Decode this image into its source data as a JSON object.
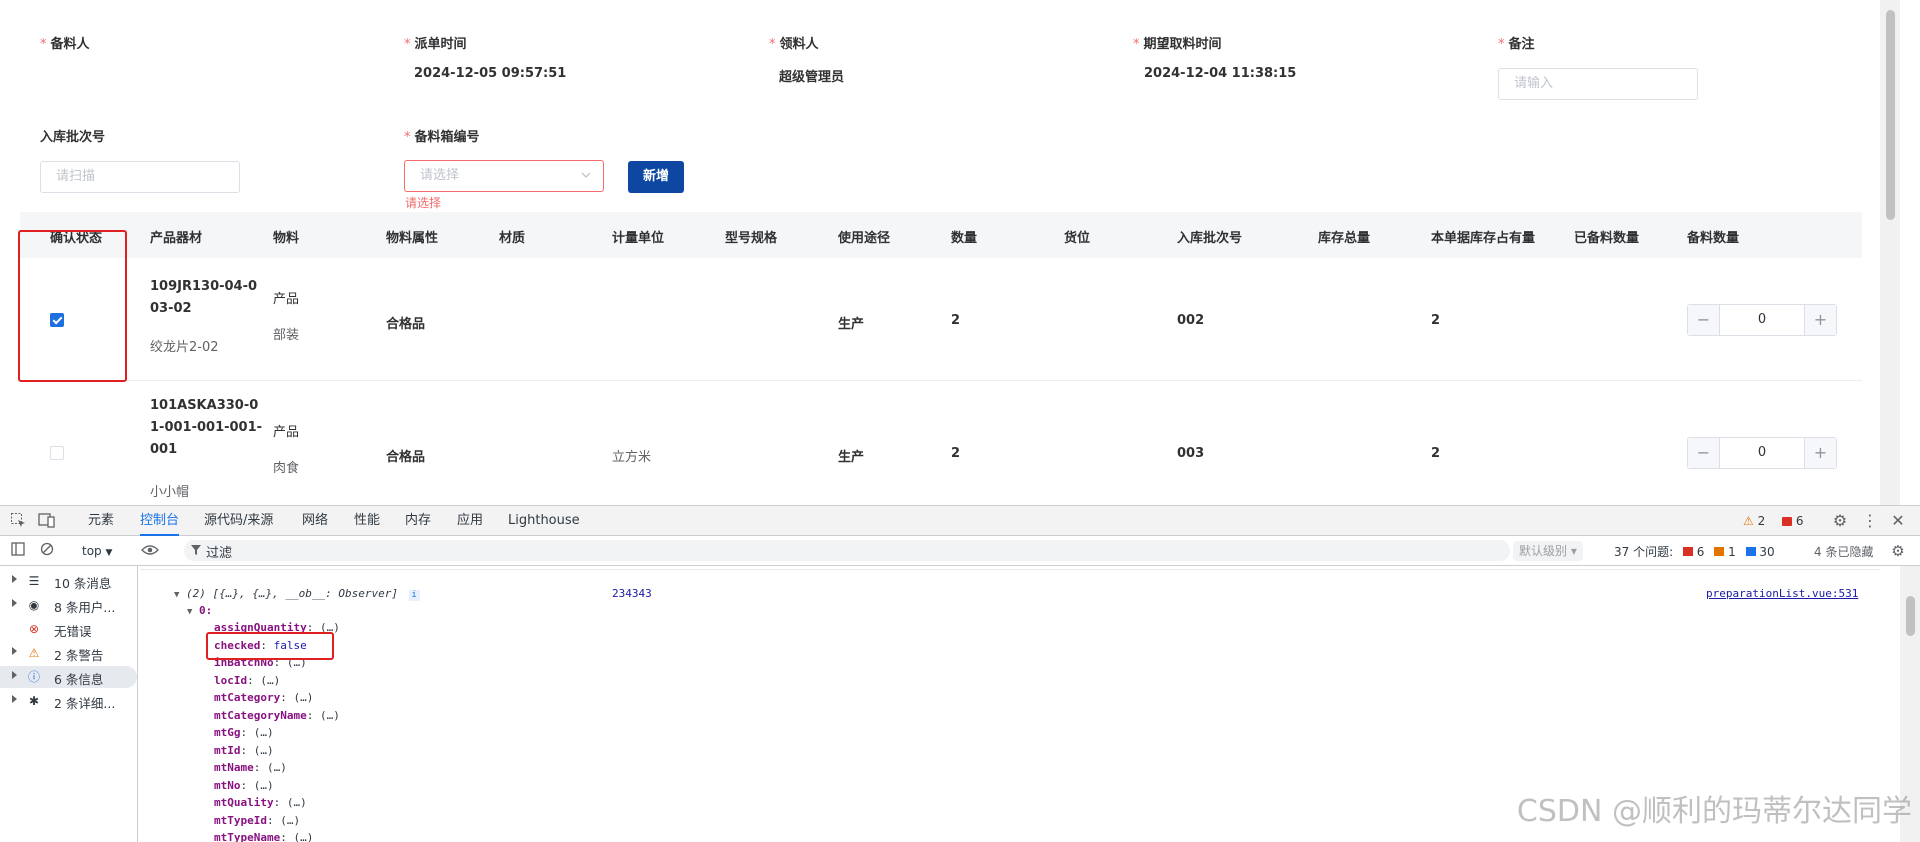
{
  "form": {
    "row1": [
      {
        "label": "备料人",
        "required": true,
        "value": ""
      },
      {
        "label": "派单时间",
        "required": true,
        "value": "2024-12-05 09:57:51"
      },
      {
        "label": "领料人",
        "required": true,
        "value": "超级管理员"
      },
      {
        "label": "期望取料时间",
        "required": true,
        "value": "2024-12-04 11:38:15"
      },
      {
        "label": "备注",
        "required": true,
        "placeholder": "请输入"
      }
    ],
    "batch_label": "入库批次号",
    "batch_placeholder": "请扫描",
    "box_label": "备料箱编号",
    "box_placeholder": "请选择",
    "box_error": "请选择",
    "add_button": "新增"
  },
  "table": {
    "headers": [
      "确认状态",
      "产品器材",
      "物料",
      "物料属性",
      "材质",
      "计量单位",
      "型号规格",
      "使用途径",
      "数量",
      "货位",
      "入库批次号",
      "库存总量",
      "本单据库存占有量",
      "已备料数量",
      "备料数量"
    ],
    "rows": [
      {
        "checked": true,
        "product_code": [
          "109JR130-04-0",
          "03-02"
        ],
        "product_name": "绞龙片2-02",
        "material_type": "产品",
        "material_sub": "部装",
        "attribute": "合格品",
        "unit": "",
        "usage": "生产",
        "quantity": "2",
        "batch": "002",
        "occupied": "2",
        "prep_qty": "0"
      },
      {
        "checked": false,
        "product_code": [
          "101ASKA330-0",
          "1-001-001-001-",
          "001"
        ],
        "product_name": "小小帽",
        "material_type": "产品",
        "material_sub": "肉食",
        "attribute": "合格品",
        "unit": "立方米",
        "usage": "生产",
        "quantity": "2",
        "batch": "003",
        "occupied": "2",
        "prep_qty": "0"
      }
    ]
  },
  "devtools": {
    "tabs": [
      "元素",
      "控制台",
      "源代码/来源",
      "网络",
      "性能",
      "内存",
      "应用",
      "Lighthouse"
    ],
    "active_tab": "控制台",
    "warnings": "2",
    "errors": "6",
    "context": "top",
    "filter_placeholder": "过滤",
    "levels": "默认级别",
    "issues_label": "37 个问题:",
    "issue_errors": "6",
    "issue_warnings": "1",
    "issue_info": "30",
    "hidden": "4 条已隐藏",
    "sidebar": [
      {
        "label": "10 条消息",
        "icon": "list-icon",
        "caret": true
      },
      {
        "label": "8 条用户...",
        "icon": "user-icon",
        "caret": true
      },
      {
        "label": "无错误",
        "icon": "error-icon",
        "caret": false
      },
      {
        "label": "2 条警告",
        "icon": "warning-icon",
        "caret": true
      },
      {
        "label": "6 条信息",
        "icon": "info-icon",
        "caret": true,
        "selected": true
      },
      {
        "label": "2 条详细...",
        "icon": "bug-icon",
        "caret": true
      }
    ],
    "console": {
      "array_summary": "(2) [{…}, {…}, __ob__: Observer]",
      "logged_value": "234343",
      "source_link": "preparationList.vue:531",
      "index": "0:",
      "props": [
        {
          "key": "assignQuantity",
          "value": "(…)"
        },
        {
          "key": "checked",
          "value": "false",
          "highlight": true
        },
        {
          "key": "inBatchNo",
          "value": "(…)"
        },
        {
          "key": "locId",
          "value": "(…)"
        },
        {
          "key": "mtCategory",
          "value": "(…)"
        },
        {
          "key": "mtCategoryName",
          "value": "(…)"
        },
        {
          "key": "mtGg",
          "value": "(…)"
        },
        {
          "key": "mtId",
          "value": "(…)"
        },
        {
          "key": "mtName",
          "value": "(…)"
        },
        {
          "key": "mtNo",
          "value": "(…)"
        },
        {
          "key": "mtQuality",
          "value": "(…)"
        },
        {
          "key": "mtTypeId",
          "value": "(…)"
        },
        {
          "key": "mtTypeName",
          "value": "(…)"
        }
      ]
    }
  },
  "watermark": "CSDN @顺利的玛蒂尔达同学"
}
